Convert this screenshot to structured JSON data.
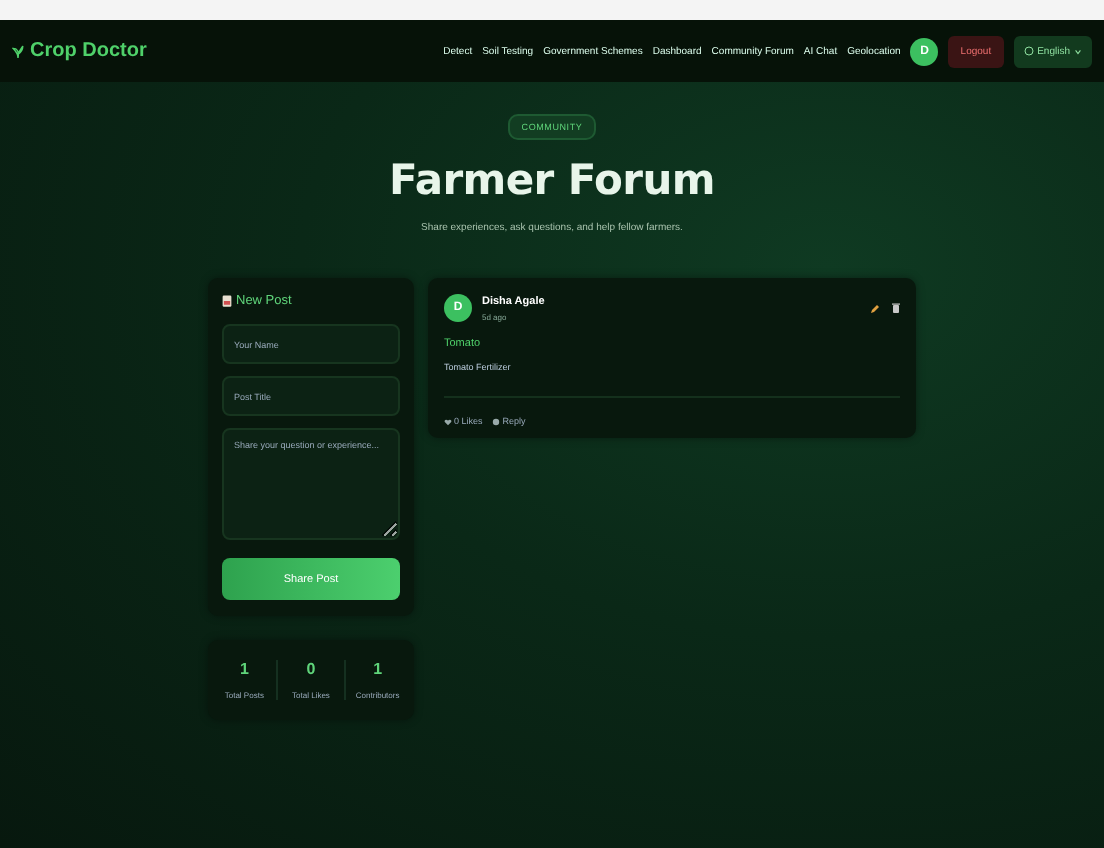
{
  "nav": {
    "brand": "Crop Doctor",
    "links": [
      {
        "label": "Detect"
      },
      {
        "label": "Soil Testing"
      },
      {
        "label": "Government Schemes"
      },
      {
        "label": "Dashboard"
      },
      {
        "label": "Community Forum"
      },
      {
        "label": "AI Chat"
      },
      {
        "label": "Geolocation"
      }
    ],
    "avatar": "D",
    "logout": "Logout",
    "language": "English"
  },
  "hero": {
    "badge": "COMMUNITY",
    "title": "Farmer Forum",
    "subtitle": "Share experiences, ask questions, and help fellow farmers."
  },
  "new_post": {
    "heading": "New Post",
    "fields": [
      {
        "kind": "input",
        "placeholder": "Your Name"
      },
      {
        "kind": "input",
        "placeholder": "Post Title"
      },
      {
        "kind": "textarea",
        "placeholder": "Share your question or experience..."
      }
    ],
    "submit": "Share Post"
  },
  "stats": [
    {
      "value": "1",
      "label": "Total Posts"
    },
    {
      "value": "0",
      "label": "Total Likes"
    },
    {
      "value": "1",
      "label": "Contributors"
    }
  ],
  "posts": [
    {
      "avatar": "D",
      "author": "Disha Agale",
      "time": "5d ago",
      "title": "Tomato",
      "body": "Tomato Fertilizer",
      "likes": "0 Likes",
      "reply": "Reply"
    }
  ]
}
